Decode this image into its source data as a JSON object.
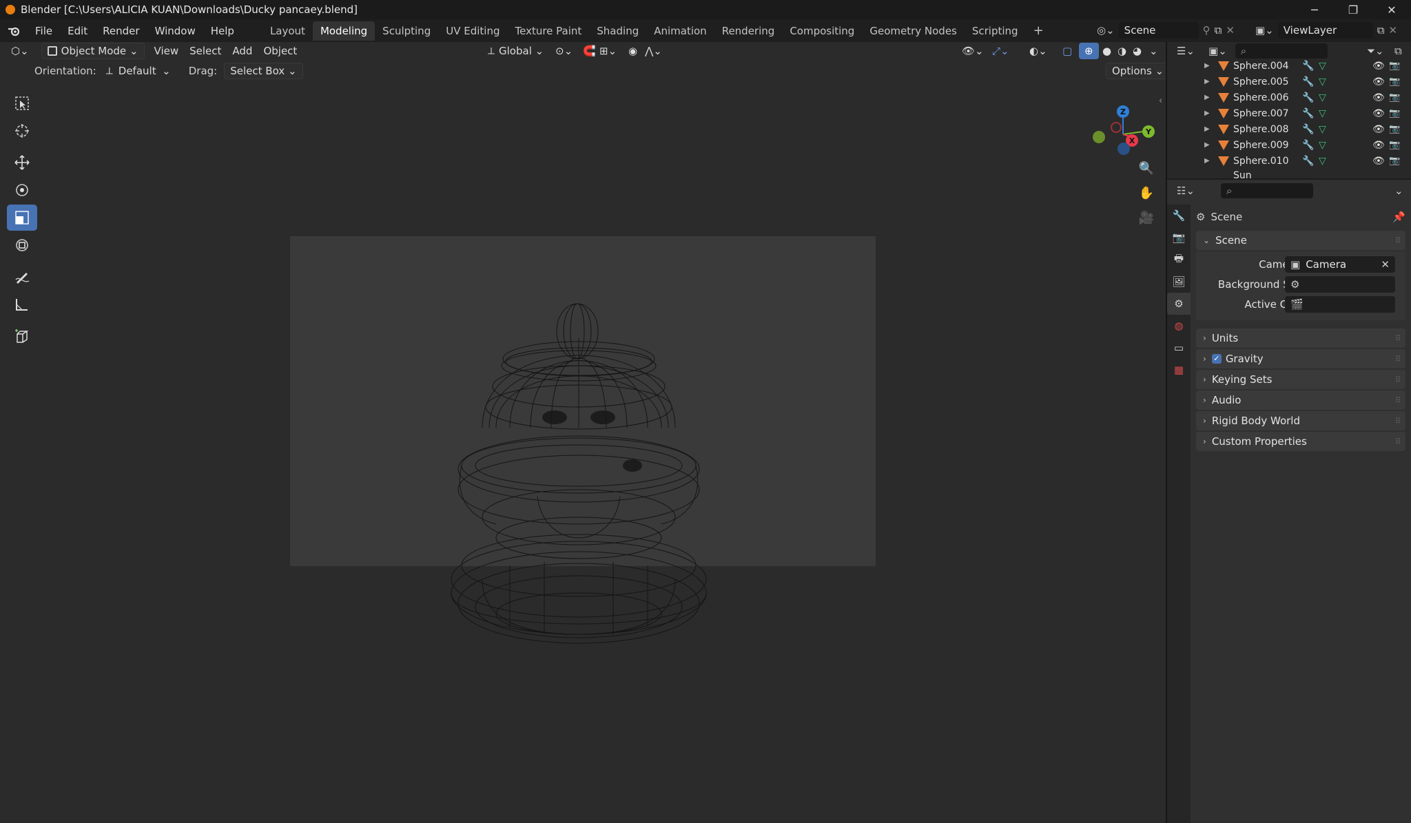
{
  "window": {
    "title": "Blender [C:\\Users\\ALICIA KUAN\\Downloads\\Ducky pancaey.blend]",
    "minimize": "─",
    "maximize": "❐",
    "close": "✕"
  },
  "menubar": {
    "menus": [
      "File",
      "Edit",
      "Render",
      "Window",
      "Help"
    ],
    "workspaces": [
      "Layout",
      "Modeling",
      "Sculpting",
      "UV Editing",
      "Texture Paint",
      "Shading",
      "Animation",
      "Rendering",
      "Compositing",
      "Geometry Nodes",
      "Scripting"
    ],
    "active_workspace": "Modeling",
    "add_workspace": "+",
    "scene": "Scene",
    "view_layer": "ViewLayer"
  },
  "viewport": {
    "mode": "Object Mode",
    "menus": [
      "View",
      "Select",
      "Add",
      "Object"
    ],
    "transform_orientation": "Global",
    "orientation_label": "Orientation:",
    "orientation_value": "Default",
    "drag_label": "Drag:",
    "drag_value": "Select Box",
    "options_label": "Options",
    "gizmo": {
      "z": "Z",
      "y": "Y",
      "x": "X"
    }
  },
  "outliner": {
    "items": [
      {
        "name": "Sphere.004"
      },
      {
        "name": "Sphere.005"
      },
      {
        "name": "Sphere.006"
      },
      {
        "name": "Sphere.007"
      },
      {
        "name": "Sphere.008"
      },
      {
        "name": "Sphere.009"
      },
      {
        "name": "Sphere.010"
      }
    ],
    "partial_item": "Sun"
  },
  "properties": {
    "context_title": "Scene",
    "scene_panel_title": "Scene",
    "camera_label": "Camera",
    "camera_value": "Camera",
    "background_label": "Background S...",
    "active_clip_label": "Active Clip",
    "panels": [
      "Units",
      "Gravity",
      "Keying Sets",
      "Audio",
      "Rigid Body World",
      "Custom Properties"
    ],
    "gravity_checked": true
  },
  "colors": {
    "accent": "#4772b3",
    "object_orange": "#e7813a",
    "gizmo_x": "#e8394a",
    "gizmo_y": "#7dbb2e",
    "gizmo_z": "#2f7fd8"
  }
}
